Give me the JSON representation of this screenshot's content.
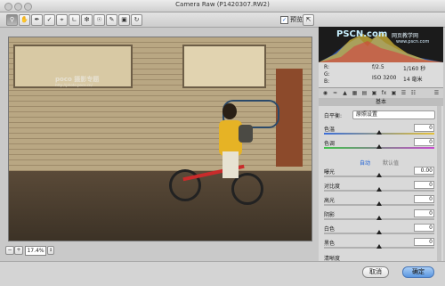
{
  "window": {
    "title": "Camera Raw (P1420307.RW2)"
  },
  "toolbar": {
    "tools": [
      "zoom-tool",
      "hand-tool",
      "white-balance-tool",
      "color-sampler-tool",
      "crop-tool",
      "straighten-tool",
      "spot-removal-tool",
      "red-eye-tool",
      "adjustment-brush-tool",
      "graduated-filter-tool",
      "rotate-tool"
    ],
    "preview_label": "预览",
    "preview_checked": true
  },
  "watermark": {
    "logo": "PS",
    "brand": "PSCN.com",
    "site": "网页教学网",
    "url": "www.pscn.com"
  },
  "photo": {
    "watermark": "poco 摄影专题",
    "watermark_url": "http://photo.poco.cn/"
  },
  "histogram": {
    "rgb": {
      "r": "R:",
      "g": "G:",
      "b": "B:",
      "r_val": "---",
      "g_val": "---",
      "b_val": "---"
    },
    "aperture": "f/2.5",
    "shutter": "1/160 秒",
    "iso": "ISO 3200",
    "focal": "14 毫米"
  },
  "panel": {
    "header": "基本",
    "white_balance_label": "白平衡:",
    "white_balance_value": "原照设置",
    "sliders": [
      {
        "label": "色温",
        "value": "0",
        "pos": 0.5
      },
      {
        "label": "色调",
        "value": "0",
        "pos": 0.5
      }
    ],
    "auto_label": "自动",
    "default_label": "默认值",
    "tone_sliders": [
      {
        "label": "曝光",
        "value": "0.00",
        "pos": 0.5
      },
      {
        "label": "对比度",
        "value": "0",
        "pos": 0.5
      },
      {
        "label": "高光",
        "value": "0",
        "pos": 0.5
      },
      {
        "label": "阴影",
        "value": "0",
        "pos": 0.5
      },
      {
        "label": "白色",
        "value": "0",
        "pos": 0.5
      },
      {
        "label": "黑色",
        "value": "0",
        "pos": 0.5
      }
    ],
    "partial_label": "清晰度"
  },
  "status": {
    "zoom": "17.4%"
  },
  "footer": {
    "cancel_label": "取消",
    "ok_label": "确定"
  },
  "colors": {
    "accent": "#5a97e0",
    "link": "#1a5fd6"
  }
}
